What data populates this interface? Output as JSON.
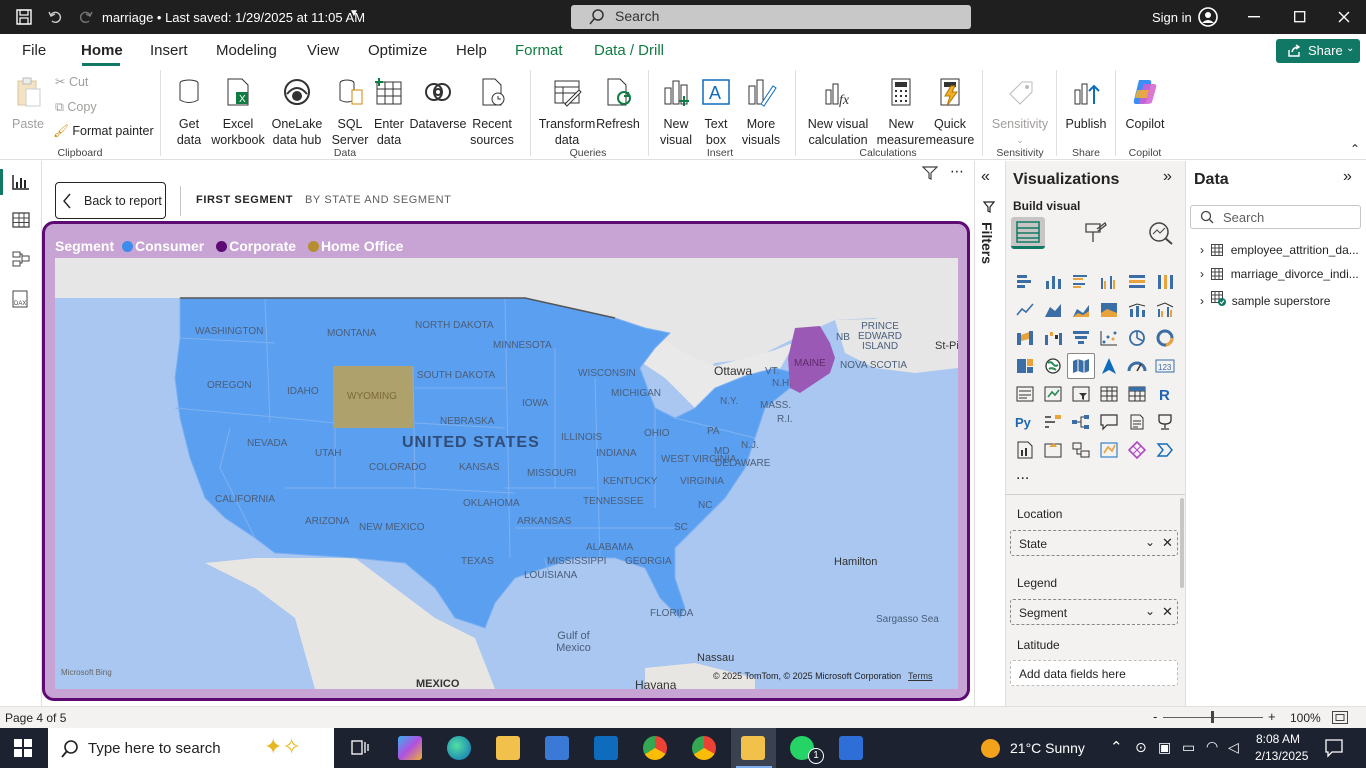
{
  "titlebar": {
    "doc_title": "marriage • Last saved: 1/29/2025 at 11:05 AM",
    "search_placeholder": "Search",
    "sign_in": "Sign in"
  },
  "tabs": [
    "File",
    "Home",
    "Insert",
    "Modeling",
    "View",
    "Optimize",
    "Help",
    "Format",
    "Data / Drill"
  ],
  "share_label": "Share",
  "ribbon": {
    "clipboard": {
      "paste": "Paste",
      "cut": "Cut",
      "copy": "Copy",
      "format_painter": "Format painter",
      "group": "Clipboard"
    },
    "data": {
      "get_data": "Get data",
      "excel": "Excel workbook",
      "onelake": "OneLake data hub",
      "sql": "SQL Server",
      "enter": "Enter data",
      "dataverse": "Dataverse",
      "recent": "Recent sources",
      "group": "Data"
    },
    "queries": {
      "transform": "Transform data",
      "refresh": "Refresh",
      "group": "Queries"
    },
    "insert": {
      "new_visual": "New visual",
      "text_box": "Text box",
      "more_visuals": "More visuals",
      "group": "Insert"
    },
    "calculations": {
      "new_calc": "New visual calculation",
      "new_measure": "New measure",
      "quick_measure": "Quick measure",
      "group": "Calculations"
    },
    "sensitivity": {
      "label": "Sensitivity",
      "group": "Sensitivity"
    },
    "share": {
      "publish": "Publish",
      "group": "Share"
    },
    "copilot": {
      "label": "Copilot",
      "group": "Copilot"
    }
  },
  "canvas": {
    "back_label": "Back to report",
    "drill_tabs": [
      "FIRST SEGMENT",
      "BY STATE AND SEGMENT"
    ]
  },
  "legend": {
    "title": "Segment",
    "items": [
      {
        "label": "Consumer",
        "color": "#3b8ced"
      },
      {
        "label": "Corporate",
        "color": "#5e0a73"
      },
      {
        "label": "Home Office",
        "color": "#b58e2f"
      }
    ]
  },
  "map": {
    "labels": [
      "WASHINGTON",
      "MONTANA",
      "NORTH DAKOTA",
      "MINNESOTA",
      "OREGON",
      "IDAHO",
      "WYOMING",
      "SOUTH DAKOTA",
      "WISCONSIN",
      "MICHIGAN",
      "NEBRASKA",
      "IOWA",
      "NEVADA",
      "UTAH",
      "UNITED STATES",
      "ILLINOIS",
      "OHIO",
      "PA",
      "COLORADO",
      "KANSAS",
      "MISSOURI",
      "INDIANA",
      "WEST VIRGINIA",
      "MD",
      "DELAWARE",
      "N.J.",
      "CALIFORNIA",
      "KENTUCKY",
      "VIRGINIA",
      "TENNESSEE",
      "NC",
      "ARIZONA",
      "NEW MEXICO",
      "OKLAHOMA",
      "ARKANSAS",
      "SC",
      "ALABAMA",
      "GEORGIA",
      "MISSISSIPPI",
      "TEXAS",
      "LOUISIANA",
      "FLORIDA",
      "MEXICO",
      "Gulf of Mexico",
      "Havana",
      "Nassau",
      "Hamilton",
      "Sargasso Sea",
      "Ottawa",
      "N.Y.",
      "MASS.",
      "R.I.",
      "N.H.",
      "VT.",
      "MAINE",
      "NB",
      "PRINCE EDWARD ISLAND",
      "NOVA SCOTIA",
      "St-Pi"
    ],
    "copyright": "© 2025 TomTom, © 2025 Microsoft Corporation",
    "terms": "Terms",
    "bing": "Microsoft Bing"
  },
  "filters_label": "Filters",
  "viz": {
    "title": "Visualizations",
    "build_visual": "Build visual",
    "more": "...",
    "wells": {
      "location_label": "Location",
      "location_value": "State",
      "legend_label": "Legend",
      "legend_value": "Segment",
      "latitude_label": "Latitude",
      "latitude_placeholder": "Add data fields here"
    }
  },
  "data_pane": {
    "title": "Data",
    "search_placeholder": "Search",
    "tables": [
      "employee_attrition_da...",
      "marriage_divorce_indi...",
      "sample superstore"
    ]
  },
  "status": {
    "page": "Page 4 of 5",
    "zoom": "100%"
  },
  "taskbar": {
    "search_placeholder": "Type here to search",
    "weather": "21°C  Sunny",
    "time": "8:08 AM",
    "date": "2/13/2025",
    "whatsapp_badge": "1"
  }
}
